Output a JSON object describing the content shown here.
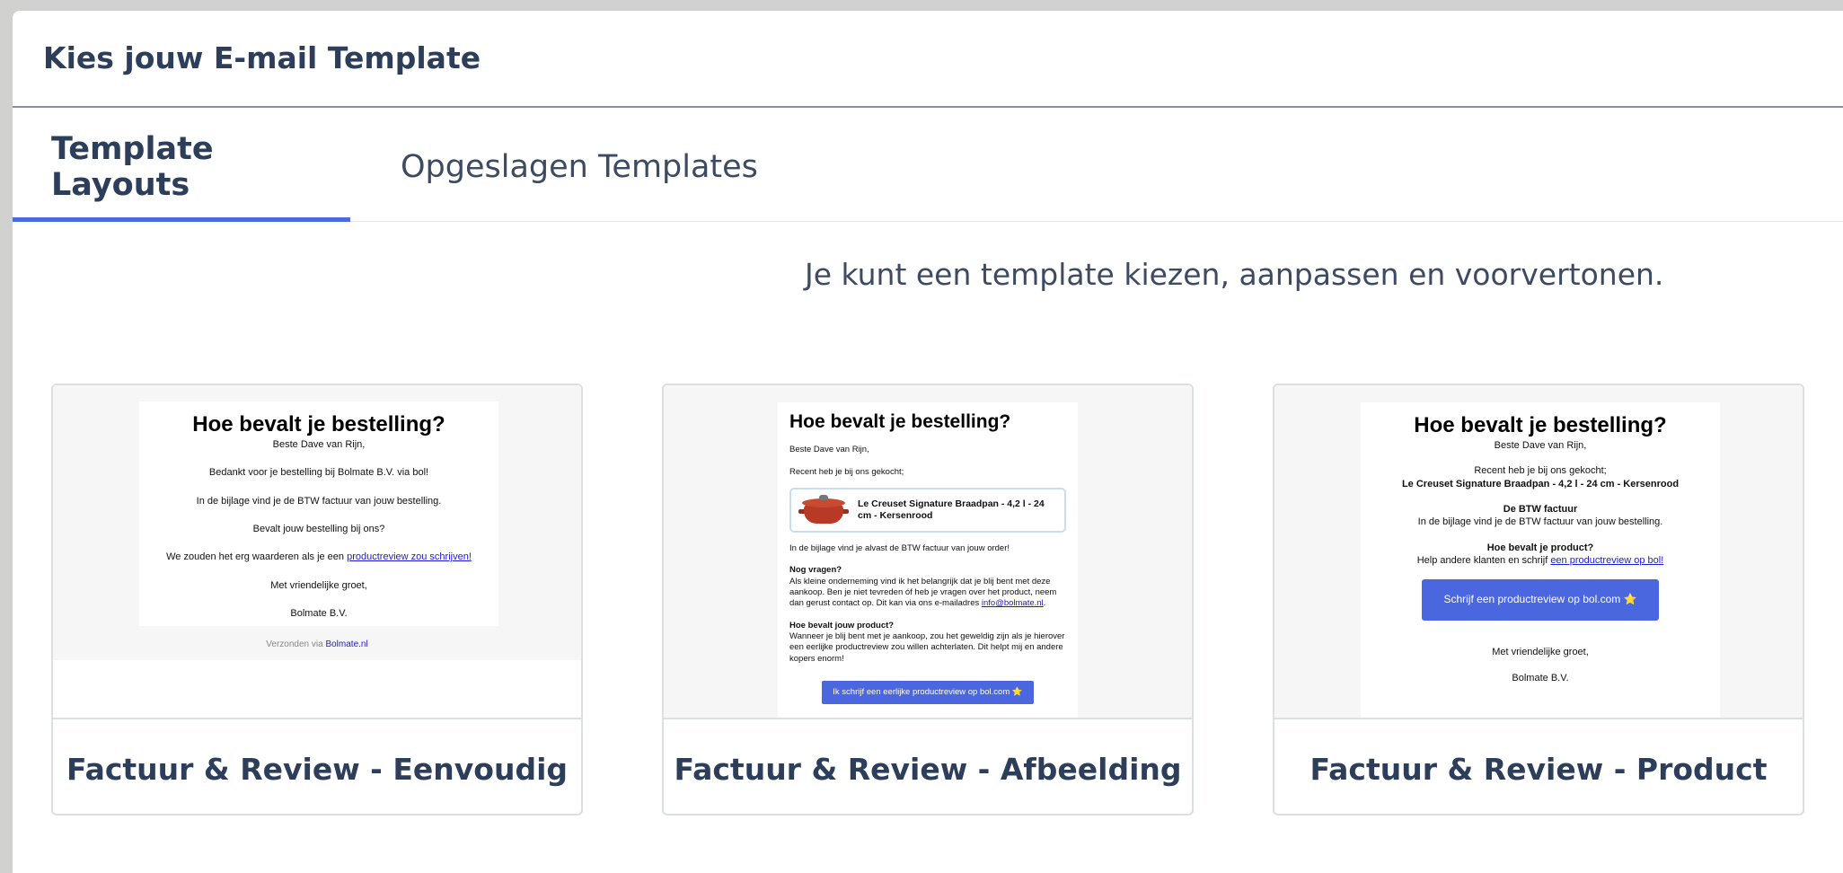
{
  "modal": {
    "title": "Kies jouw E-mail Template"
  },
  "tabs": [
    {
      "label": "Template Layouts",
      "active": true
    },
    {
      "label": "Opgeslagen Templates",
      "active": false
    }
  ],
  "intro": "Je kunt een template kiezen, aanpassen en voorvertonen.",
  "colors": {
    "accent": "#4a6ae0",
    "heading": "#2d3e5a",
    "button": "#4a67e0"
  },
  "cards": [
    {
      "title": "Factuur & Review - Eenvoudig",
      "preview": {
        "heading": "Hoe bevalt je bestelling?",
        "greeting": "Beste Dave van Rijn,",
        "thanks": "Bedankt voor je bestelling bij Bolmate B.V. via bol!",
        "attachment": "In de bijlage vind je de BTW factuur van jouw bestelling.",
        "question": "Bevalt jouw bestelling bij ons?",
        "review_prefix": "We zouden het erg waarderen als je een ",
        "review_link": "productreview zou schrijven!",
        "closing": "Met vriendelijke groet,",
        "company": "Bolmate B.V.",
        "sent_prefix": "Verzonden via ",
        "sent_link": "Bolmate.nl"
      }
    },
    {
      "title": "Factuur & Review - Afbeelding",
      "preview": {
        "heading": "Hoe bevalt je bestelling?",
        "greeting": "Beste Dave van Rijn,",
        "recent": "Recent heb je bij ons gekocht;",
        "product_name": "Le Creuset Signature Braadpan - 4,2 l - 24 cm - Kersenrood",
        "attachment": "In de bijlage vind je alvast de BTW factuur van jouw order!",
        "questions_title": "Nog vragen?",
        "questions_text": "Als kleine onderneming vind ik het belangrijk dat je blij bent met deze aankoop. Ben je niet tevreden óf heb je vragen over het product, neem dan gerust contact op. Dit kan via ons e-mailadres ",
        "email_link": "info@bolmate.nl",
        "product_title": "Hoe bevalt jouw product?",
        "product_text": "Wanneer je blij bent met je aankoop, zou het geweldig zijn als je hierover een eerlijke productreview zou willen achterlaten. Dit helpt mij en andere kopers enorm!",
        "button": "Ik schrijf een eerlijke productreview op bol.com ⭐"
      }
    },
    {
      "title": "Factuur & Review - Product",
      "preview": {
        "heading": "Hoe bevalt je bestelling?",
        "greeting": "Beste Dave van Rijn,",
        "recent": "Recent heb je bij ons gekocht;",
        "product_name": "Le Creuset Signature Braadpan - 4,2 l - 24 cm - Kersenrood",
        "invoice_title": "De BTW factuur",
        "invoice_text": "In de bijlage vind je de BTW factuur van jouw bestelling.",
        "product_title": "Hoe bevalt je product?",
        "help_prefix": "Help andere klanten en schrijf ",
        "help_link": "een productreview op bol!",
        "button": "Schrijf een productreview op bol.com ⭐",
        "closing": "Met vriendelijke groet,",
        "company": "Bolmate B.V."
      }
    }
  ]
}
